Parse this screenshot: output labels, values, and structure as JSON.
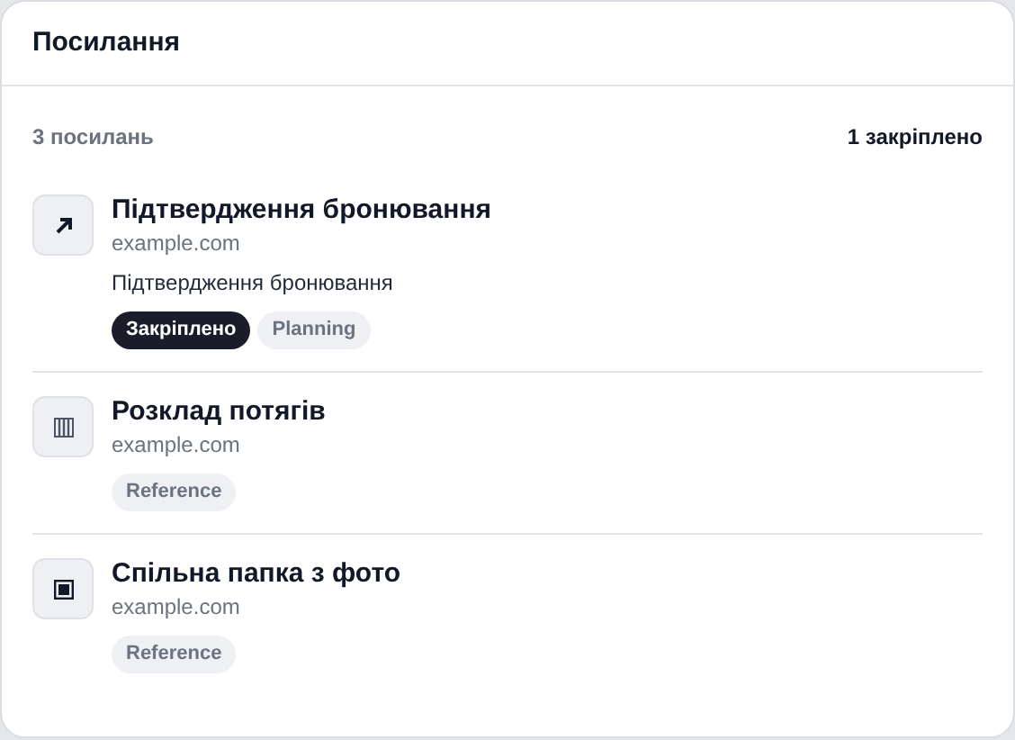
{
  "title": "Посилання",
  "summary": {
    "count": "3 посилань",
    "pinned": "1 закріплено"
  },
  "links": [
    {
      "kind": "arrow",
      "title": "Підтвердження бронювання",
      "url": "example.com",
      "description": "Підтвердження бронювання",
      "tags": [
        {
          "label": "Закріплено",
          "kind": "pinned"
        },
        {
          "label": "Planning",
          "kind": "category"
        }
      ]
    },
    {
      "kind": "bars",
      "title": "Розклад потягів",
      "url": "example.com",
      "tags": [
        {
          "label": "Reference",
          "kind": "category"
        }
      ]
    },
    {
      "kind": "square",
      "title": "Спільна папка з фото",
      "url": "example.com",
      "tags": [
        {
          "label": "Reference",
          "kind": "category"
        }
      ]
    }
  ]
}
